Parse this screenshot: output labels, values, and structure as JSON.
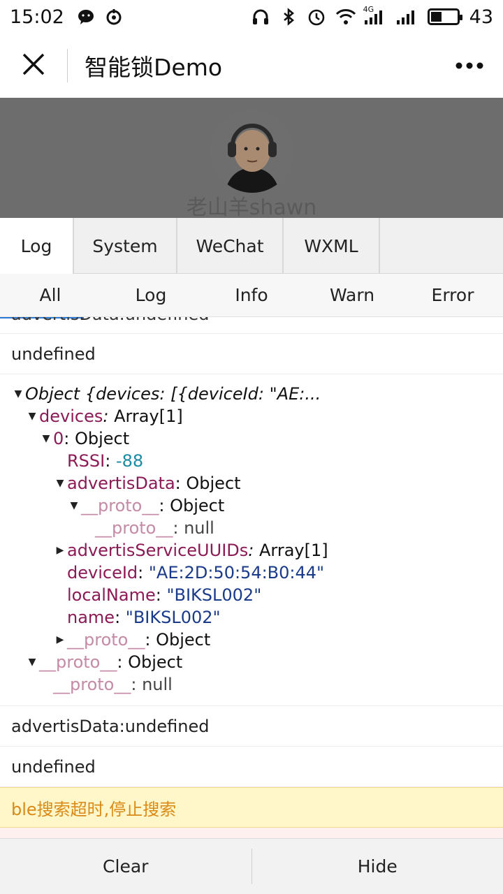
{
  "status_bar": {
    "time": "15:02",
    "network_label": "4G",
    "battery_level_percent": 43,
    "battery_text": "43",
    "icons": [
      "wechat-icon",
      "sync-icon",
      "headphones-icon",
      "bluetooth-icon",
      "alarm-icon",
      "wifi-icon",
      "signal-icon",
      "signal-icon",
      "battery-icon"
    ]
  },
  "titlebar": {
    "title": "智能锁Demo",
    "close_icon": "close-icon",
    "more_icon": "more-icon"
  },
  "profile": {
    "username": "老山羊shawn"
  },
  "tabs": [
    {
      "label": "Log",
      "active": true
    },
    {
      "label": "System",
      "active": false
    },
    {
      "label": "WeChat",
      "active": false
    },
    {
      "label": "WXML",
      "active": false
    }
  ],
  "filters": [
    "All",
    "Log",
    "Info",
    "Warn",
    "Error"
  ],
  "logs": {
    "clipped_top": "advertisData:undefined",
    "line1": "undefined",
    "object": {
      "summary": "Object {devices: [{deviceId: \"AE:...",
      "devices_key": "devices",
      "devices_val": "Array[1]",
      "item_key": "0",
      "item_val": "Object",
      "rssi_key": "RSSI",
      "rssi_val": "-88",
      "adv_key": "advertisData",
      "adv_val": "Object",
      "proto_key": "__proto__",
      "proto_obj": "Object",
      "proto_null": "null",
      "uuids_key": "advertisServiceUUIDs",
      "uuids_val": "Array[1]",
      "deviceid_key": "deviceId",
      "deviceid_val": "\"AE:2D:50:54:B0:44\"",
      "localname_key": "localName",
      "localname_val": "\"BIKSL002\"",
      "name_key": "name",
      "name_val": "\"BIKSL002\""
    },
    "line2": "advertisData:undefined",
    "line3": "undefined",
    "warn": "ble搜索超时,停止搜索"
  },
  "bottom": {
    "clear": "Clear",
    "hide": "Hide"
  }
}
